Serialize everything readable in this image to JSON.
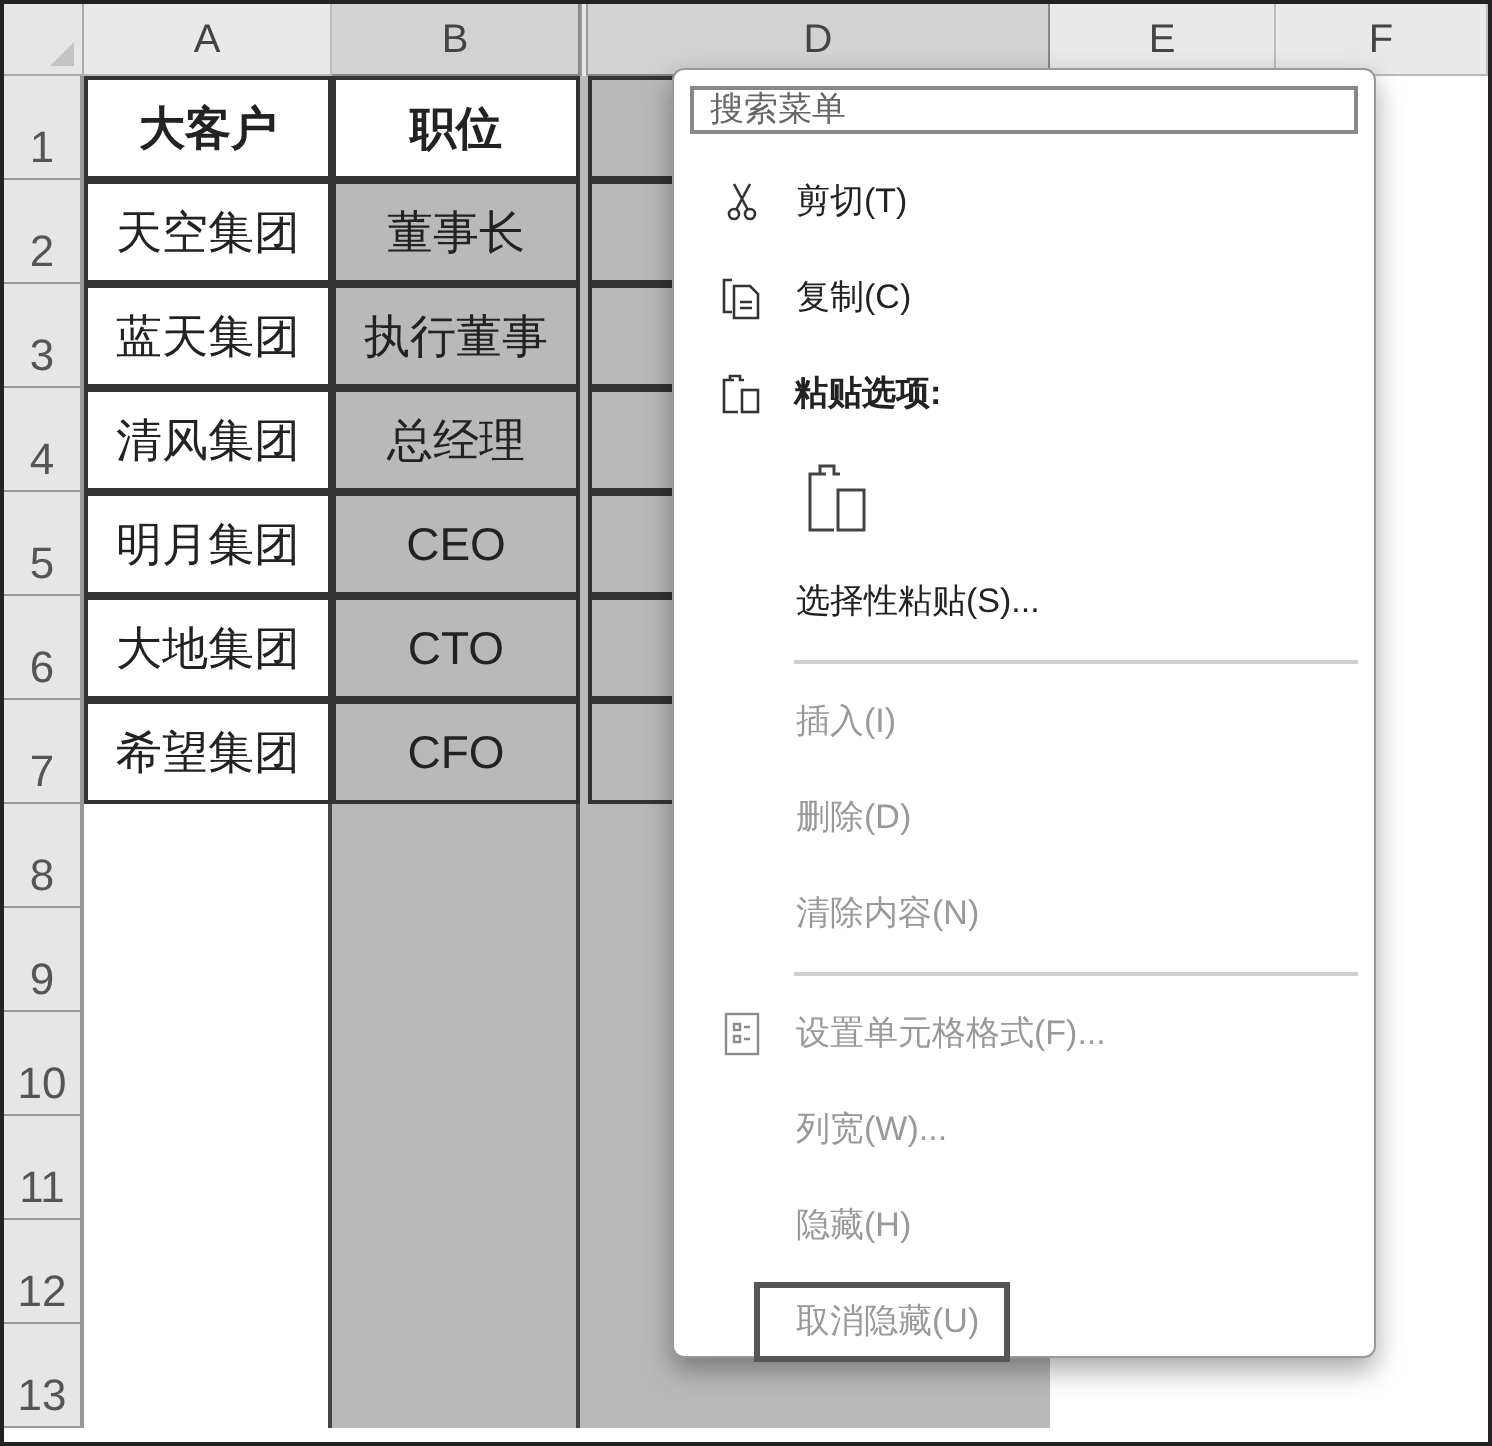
{
  "columns": [
    {
      "label": "A",
      "selected": false
    },
    {
      "label": "B",
      "selected": true
    },
    {
      "label": "D",
      "selected": true
    },
    {
      "label": "E",
      "selected": false
    },
    {
      "label": "F",
      "selected": false
    }
  ],
  "rows": [
    {
      "number": "1",
      "cells": [
        {
          "text": "大客户",
          "bold": true,
          "selected": false
        },
        {
          "text": "职位",
          "bold": true,
          "selected": false
        },
        {
          "selected": true
        }
      ]
    },
    {
      "number": "2",
      "cells": [
        {
          "text": "天空集团",
          "bold": false,
          "selected": false
        },
        {
          "text": "董事长",
          "bold": false,
          "selected": true
        },
        {
          "selected": true
        }
      ]
    },
    {
      "number": "3",
      "cells": [
        {
          "text": "蓝天集团",
          "bold": false,
          "selected": false
        },
        {
          "text": "执行董事",
          "bold": false,
          "selected": true
        },
        {
          "selected": true
        }
      ]
    },
    {
      "number": "4",
      "cells": [
        {
          "text": "清风集团",
          "bold": false,
          "selected": false
        },
        {
          "text": "总经理",
          "bold": false,
          "selected": true
        },
        {
          "selected": true
        }
      ]
    },
    {
      "number": "5",
      "cells": [
        {
          "text": "明月集团",
          "bold": false,
          "selected": false
        },
        {
          "text": "CEO",
          "bold": false,
          "selected": true
        },
        {
          "selected": true
        }
      ]
    },
    {
      "number": "6",
      "cells": [
        {
          "text": "大地集团",
          "bold": false,
          "selected": false
        },
        {
          "text": "CTO",
          "bold": false,
          "selected": true
        },
        {
          "selected": true
        }
      ]
    },
    {
      "number": "7",
      "cells": [
        {
          "text": "希望集团",
          "bold": false,
          "selected": false
        },
        {
          "text": "CFO",
          "bold": false,
          "selected": true
        },
        {
          "selected": true
        }
      ]
    },
    {
      "number": "8"
    },
    {
      "number": "9"
    },
    {
      "number": "10"
    },
    {
      "number": "11"
    },
    {
      "number": "12"
    },
    {
      "number": "13"
    }
  ],
  "context_menu": {
    "search": {
      "placeholder": "搜索菜单"
    },
    "items": [
      {
        "kind": "item",
        "label": "剪切(T)",
        "disabled": false,
        "selected": false
      },
      {
        "kind": "item",
        "label": "复制(C)",
        "disabled": false,
        "selected": false
      },
      {
        "kind": "header",
        "label": "粘贴选项:"
      },
      {
        "kind": "paste-option"
      },
      {
        "kind": "item",
        "label": "选择性粘贴(S)...",
        "disabled": false,
        "selected": false
      },
      {
        "kind": "separator"
      },
      {
        "kind": "item",
        "label": "插入(I)",
        "disabled": true,
        "selected": false
      },
      {
        "kind": "item",
        "label": "删除(D)",
        "disabled": true,
        "selected": false
      },
      {
        "kind": "item",
        "label": "清除内容(N)",
        "disabled": true,
        "selected": false
      },
      {
        "kind": "separator"
      },
      {
        "kind": "item",
        "label": "设置单元格格式(F)...",
        "disabled": true,
        "selected": false
      },
      {
        "kind": "item",
        "label": "列宽(W)...",
        "disabled": true,
        "selected": false
      },
      {
        "kind": "item",
        "label": "隐藏(H)",
        "disabled": true,
        "selected": false
      },
      {
        "kind": "item",
        "label": "取消隐藏(U)",
        "disabled": true,
        "selected": true
      }
    ]
  }
}
